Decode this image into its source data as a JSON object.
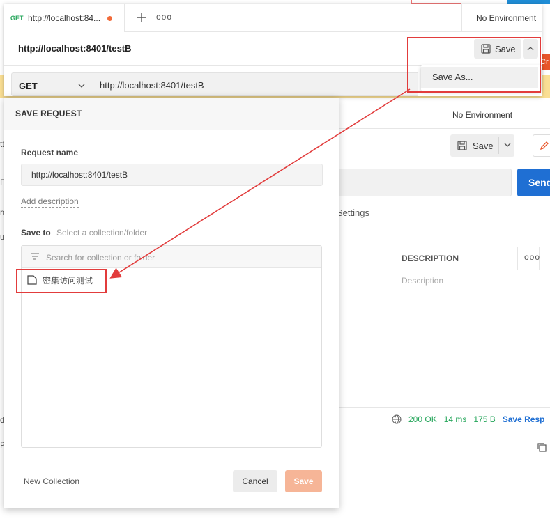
{
  "background": {
    "env_label": "No Environment",
    "save_label": "Save",
    "send_label": "Send",
    "cr_label": "Cr",
    "settings_label": "Settings",
    "table": {
      "description_header": "DESCRIPTION",
      "more": "ooo",
      "description_placeholder": "Description"
    },
    "status": {
      "code": "200 OK",
      "time": "14 ms",
      "size": "175 B",
      "save_response": "Save Resp"
    },
    "left_stubs": [
      "tt",
      "E",
      "ra",
      "u",
      "dy",
      "P"
    ]
  },
  "tab_window": {
    "tab": {
      "method": "GET",
      "title": "http://localhost:84...",
      "unsaved": true
    },
    "more_label": "ooo",
    "env_label": "No Environment",
    "request_name": "http://localhost:8401/testB",
    "save_label": "Save",
    "method": "GET",
    "url": "http://localhost:8401/testB",
    "dropdown": {
      "items": [
        "Save As..."
      ]
    }
  },
  "modal": {
    "title": "SAVE REQUEST",
    "request_name_label": "Request name",
    "request_name_value": "http://localhost:8401/testB",
    "add_description": "Add description",
    "save_to_label": "Save to",
    "save_to_hint": "Select a collection/folder",
    "search_placeholder": "Search for collection or folder",
    "collections": [
      "密集访问测试"
    ],
    "new_collection": "New Collection",
    "cancel_label": "Cancel",
    "save_label": "Save"
  },
  "colors": {
    "accent_orange": "#f26b3a",
    "save_disabled": "#f6b597",
    "send_blue": "#1f6fd3",
    "status_green": "#26a65b",
    "annotation_red": "#e23c3c"
  }
}
